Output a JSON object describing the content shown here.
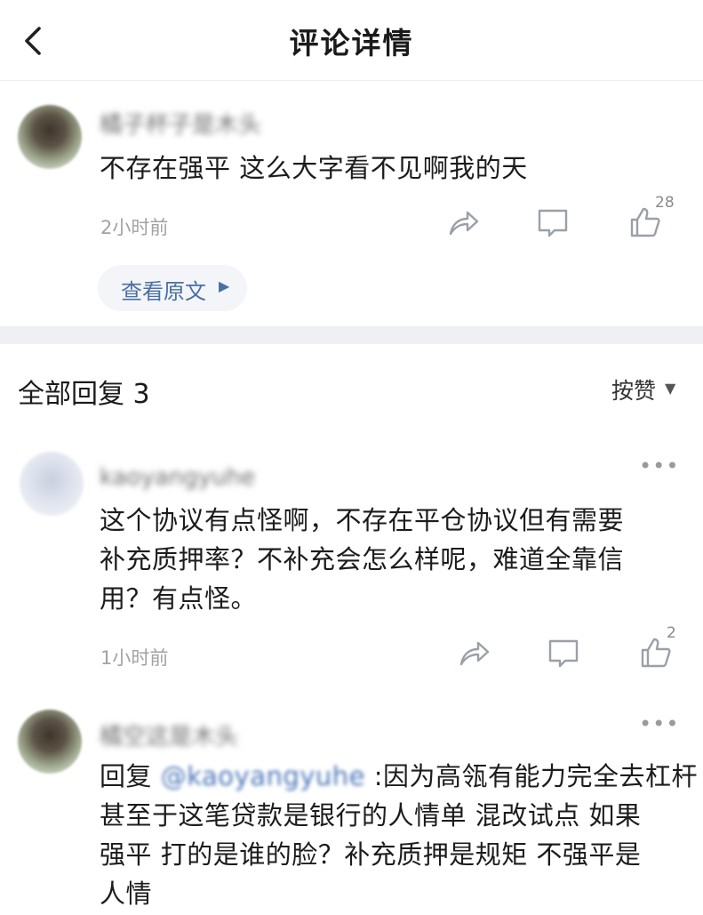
{
  "header": {
    "title": "评论详情",
    "back_icon": "chevron-left-icon"
  },
  "main_comment": {
    "author": "橘子杯子是木头",
    "text": "不存在强平 这么大字看不见啊我的天",
    "time": "2小时前",
    "like_count": "28",
    "view_original_label": "查看原文"
  },
  "replies_section": {
    "title": "全部回复 3",
    "sort_label": "按赞"
  },
  "replies": [
    {
      "author": "kaoyangyuhe",
      "lines": [
        "这个协议有点怪啊，不存在平仓协议但有需要",
        "补充质押率？不补充会怎么样呢，难道全靠信",
        "用？有点怪。"
      ],
      "time": "1小时前",
      "like_count": "2"
    },
    {
      "author": "橘空这是木头",
      "prefix": "回复",
      "mention": "@kaoyangyuhe",
      "line1_rest": ":因为高瓴有能力完全去杠杆",
      "lines": [
        "甚至于这笔贷款是银行的人情单 混改试点 如果",
        "强平 打的是谁的脸？补充质押是规矩 不强平是",
        "人情"
      ]
    }
  ],
  "colors": {
    "accent": "#4a6fa5",
    "icon_gray": "#9aa0a8",
    "divider": "#eef0f4"
  }
}
